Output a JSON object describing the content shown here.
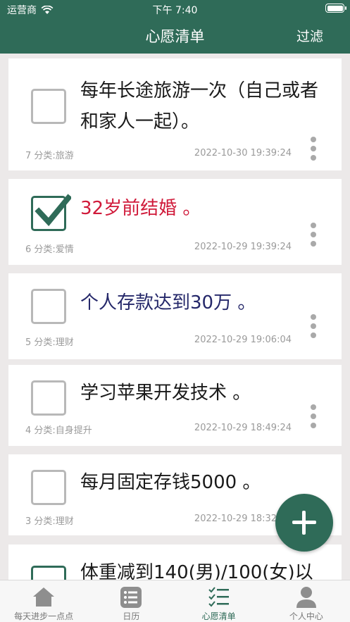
{
  "status": {
    "carrier": "运营商",
    "time": "下午 7:40"
  },
  "nav": {
    "title": "心愿清单",
    "filter_label": "过滤"
  },
  "wishes": [
    {
      "title": "每年长途旅游一次（自己或者和家人一起）。",
      "done": false,
      "meta": "7  分类:旅游",
      "date": "2022-10-30 19:39:24",
      "color": "#1a1a1a"
    },
    {
      "title": "32岁前结婚 。",
      "done": true,
      "meta": "6  分类:爱情",
      "date": "2022-10-29 19:39:24",
      "color": "#d01a3a"
    },
    {
      "title": "个人存款达到30万 。",
      "done": false,
      "meta": "5  分类:理财",
      "date": "2022-10-29 19:06:04",
      "color": "#25286a"
    },
    {
      "title": "学习苹果开发技术 。",
      "done": false,
      "meta": "4  分类:自身提升",
      "date": "2022-10-29 18:49:24",
      "color": "#1a1a1a"
    },
    {
      "title": "每月固定存钱5000 。",
      "done": false,
      "meta": "3  分类:理财",
      "date": "2022-10-29 18:32:44",
      "color": "#1a1a1a"
    },
    {
      "title": "体重减到140(男)/100(女)以",
      "done": true,
      "meta": "",
      "date": "",
      "color": "#1a1a1a"
    }
  ],
  "tabs": [
    {
      "label": "每天进步一点点",
      "icon": "house-icon"
    },
    {
      "label": "日历",
      "icon": "list-icon"
    },
    {
      "label": "心愿清单",
      "icon": "checklist-icon"
    },
    {
      "label": "个人中心",
      "icon": "person-icon"
    }
  ],
  "colors": {
    "primary": "#2f6b58",
    "done_title": "#d01a3a",
    "savings_title": "#25286a"
  }
}
